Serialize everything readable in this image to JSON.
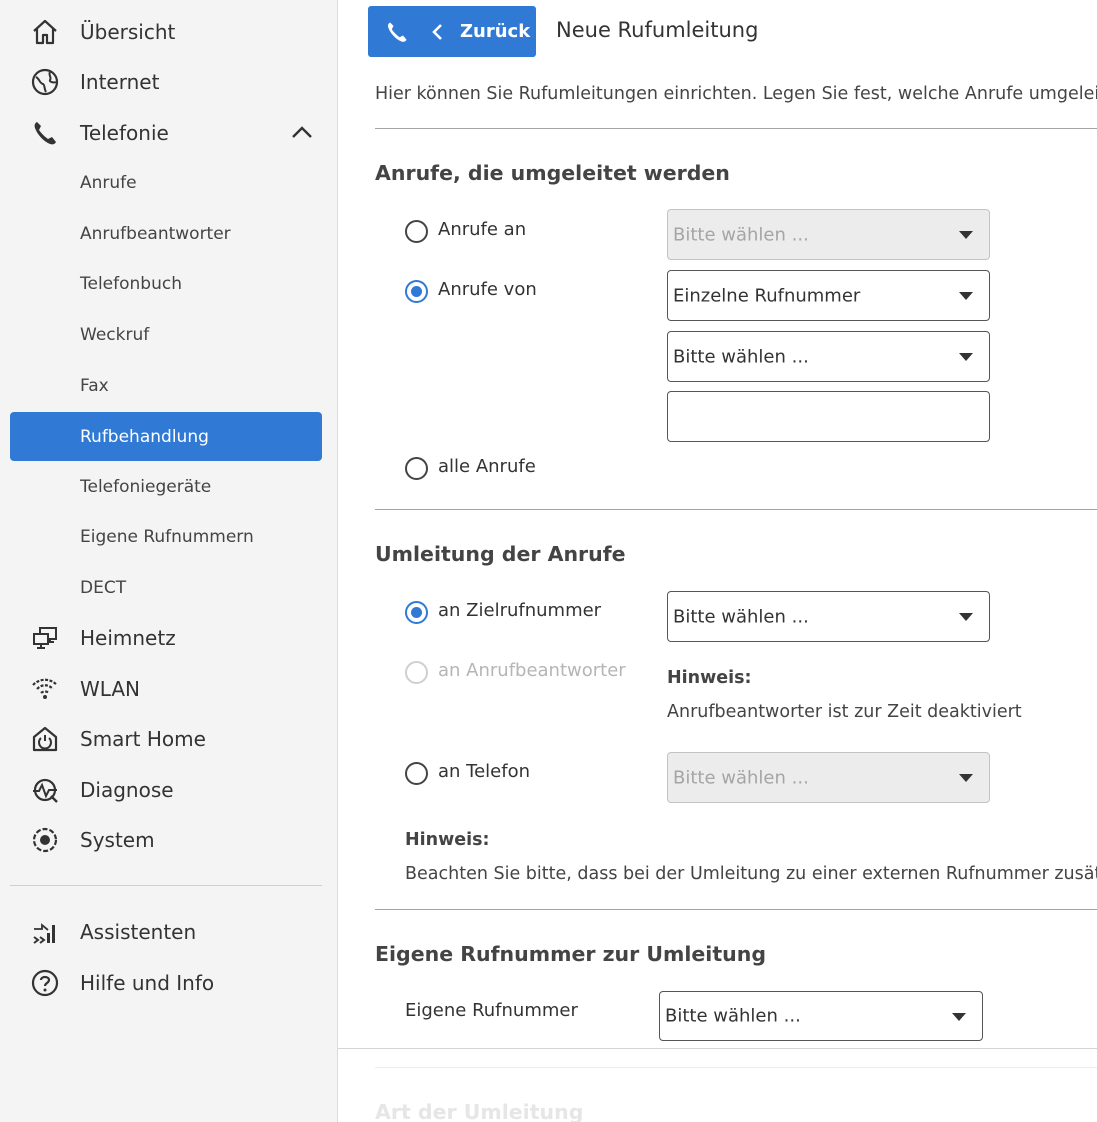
{
  "sidebar": {
    "main_items": [
      {
        "label": "Übersicht",
        "icon": "home-icon"
      },
      {
        "label": "Internet",
        "icon": "globe-icon"
      },
      {
        "label": "Telefonie",
        "icon": "phone-icon"
      },
      {
        "label": "Heimnetz",
        "icon": "network-icon"
      },
      {
        "label": "WLAN",
        "icon": "wifi-icon"
      },
      {
        "label": "Smart Home",
        "icon": "smart-home-icon"
      },
      {
        "label": "Diagnose",
        "icon": "diagnose-icon"
      },
      {
        "label": "System",
        "icon": "system-icon"
      }
    ],
    "sub_items": [
      {
        "label": "Anrufe"
      },
      {
        "label": "Anrufbeantworter"
      },
      {
        "label": "Telefonbuch"
      },
      {
        "label": "Weckruf"
      },
      {
        "label": "Fax"
      },
      {
        "label": "Rufbehandlung",
        "active": true
      },
      {
        "label": "Telefoniegeräte"
      },
      {
        "label": "Eigene Rufnummern"
      },
      {
        "label": "DECT"
      }
    ],
    "footer_items": [
      {
        "label": "Assistenten",
        "icon": "assistant-icon"
      },
      {
        "label": "Hilfe und Info",
        "icon": "help-icon"
      }
    ],
    "active_color": "#3079d5"
  },
  "header": {
    "back_label": "Zurück",
    "title": "Neue Rufumleitung"
  },
  "intro": "Hier können Sie Rufumleitungen einrichten. Legen Sie fest, welche Anrufe umgeleitet w",
  "section1": {
    "title": "Anrufe, die umgeleitet werden",
    "options": [
      {
        "label": "Anrufe an",
        "checked": false
      },
      {
        "label": "Anrufe von",
        "checked": true
      },
      {
        "label": "alle Anrufe",
        "checked": false
      }
    ],
    "select_an": "Bitte wählen ...",
    "select_von_type": "Einzelne Rufnummer",
    "select_von_number": "Bitte wählen ...",
    "text_value": ""
  },
  "section2": {
    "title": "Umleitung der Anrufe",
    "options": [
      {
        "label": "an Zielrufnummer",
        "checked": true
      },
      {
        "label": "an Anrufbeantworter",
        "checked": false,
        "disabled": true
      },
      {
        "label": "an Telefon",
        "checked": false
      }
    ],
    "select_ziel": "Bitte wählen ...",
    "ab_hint_title": "Hinweis:",
    "ab_hint_text": "Anrufbeantworter ist zur Zeit deaktiviert",
    "select_telefon": "Bitte wählen ...",
    "hint_title": "Hinweis:",
    "hint_text": "Beachten Sie bitte, dass bei der Umleitung zu einer externen Rufnummer zusätz"
  },
  "section3": {
    "title": "Eigene Rufnummer zur Umleitung",
    "field_label": "Eigene Rufnummer",
    "select_value": "Bitte wählen ..."
  },
  "section4": {
    "title": "Art der Umleitung"
  }
}
